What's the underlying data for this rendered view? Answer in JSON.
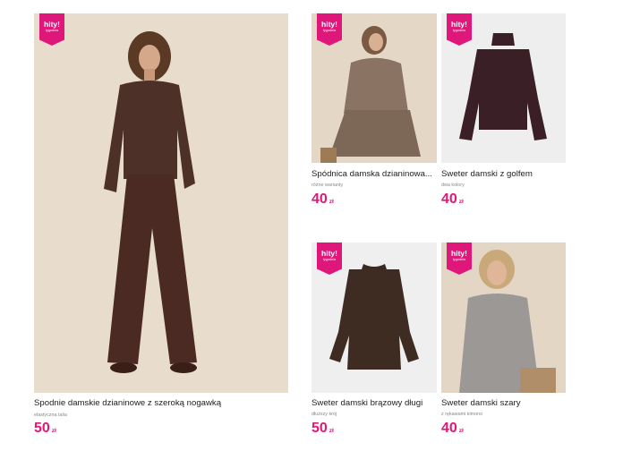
{
  "products": [
    {
      "title": "Spodnie damskie dzianinowe z szeroką nogawką",
      "subtitle": "elastyczna talia",
      "price": "50",
      "currency": "zł",
      "badge_main": "hity!",
      "badge_sub": "tygodnia"
    },
    {
      "title": "Spódnica damska dzianinowa...",
      "subtitle": "różne warianty",
      "price": "40",
      "currency": "zł",
      "badge_main": "hity!",
      "badge_sub": "tygodnia"
    },
    {
      "title": "Sweter damski z golfem",
      "subtitle": "dwa kolory",
      "price": "40",
      "currency": "zł",
      "badge_main": "hity!",
      "badge_sub": "tygodnia"
    },
    {
      "title": "Sweter damski brązowy długi",
      "subtitle": "dłuższy krój",
      "price": "50",
      "currency": "zł",
      "badge_main": "hity!",
      "badge_sub": "tygodnia"
    },
    {
      "title": "Sweter damski szary",
      "subtitle": "z rękawami kimono",
      "price": "40",
      "currency": "zł",
      "badge_main": "hity!",
      "badge_sub": "tygodnia"
    }
  ],
  "colors": {
    "accent": "#e0177a",
    "title": "#222222",
    "subtitle": "#888888"
  }
}
